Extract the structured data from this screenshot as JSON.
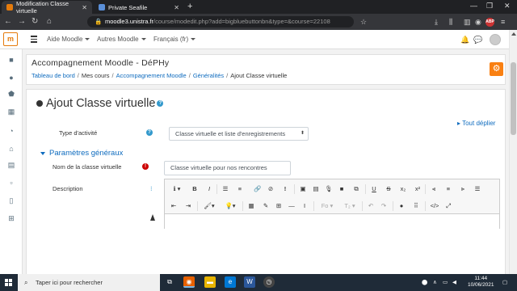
{
  "browser": {
    "tabs": [
      {
        "title": "Modification Classe virtuelle"
      },
      {
        "title": "Private Seafile"
      }
    ],
    "address": {
      "host": "moodle3.unistra.fr",
      "rest": "/course/modedit.php?add=bigbluebuttonbn&type=&course=22108"
    }
  },
  "colors": {
    "primary_link": "#0f6cbf",
    "moodle_orange": "#f98012",
    "required_red": "#c00",
    "taskbar": "#1f2b38"
  },
  "nav": {
    "menu1": "Aide Moodle",
    "menu2": "Autres Moodle",
    "lang": "Français ‎(fr)‎"
  },
  "page": {
    "course_title": "Accompagnement Moodle - DéPHy",
    "breadcrumb": [
      "Tableau de bord",
      "Mes cours",
      "Accompagnement Moodle",
      "Généralités",
      "Ajout Classe virtuelle"
    ],
    "title": "Ajout Classe virtuelle",
    "expand_all": "Tout déplier",
    "activity_type_label": "Type d'activité",
    "activity_type_value": "Classe virtuelle et liste d'enregistrements",
    "section": "Paramètres généraux",
    "name_label": "Nom de la classe virtuelle",
    "name_value": "Classe virtuelle pour nos rencontres",
    "description_label": "Description"
  },
  "editor": {
    "row1": [
      "info-icon",
      "bold",
      "italic",
      "bullet-list",
      "numbered-list",
      "link",
      "unlink",
      "important",
      "image",
      "media",
      "record-audio",
      "record-video",
      "manage-files",
      "underline",
      "strikethrough",
      "subscript",
      "superscript",
      "align-left",
      "align-center",
      "align-right",
      "justify"
    ],
    "row2_labels": {
      "font": "Fo",
      "size": "T₂"
    }
  },
  "taskbar": {
    "search_placeholder": "Taper ici pour rechercher",
    "time": "11:44",
    "date": "10/06/2021"
  }
}
